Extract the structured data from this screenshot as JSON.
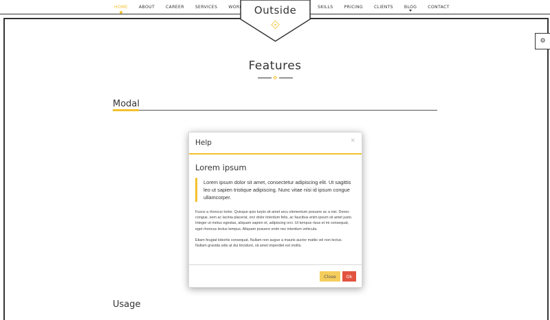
{
  "nav": {
    "left": [
      "HOME",
      "ABOUT",
      "CAREER",
      "SERVICES",
      "WORKS"
    ],
    "right": [
      "SKILLS",
      "PRICING",
      "CLIENTS",
      "BLOG",
      "CONTACT"
    ],
    "active": "HOME"
  },
  "logo": {
    "text": "Outside"
  },
  "settings": {
    "icon": "gear-icon"
  },
  "features": {
    "title": "Features"
  },
  "sections": {
    "modal_title": "Modal",
    "usage_title": "Usage"
  },
  "modal": {
    "title": "Help",
    "close_icon": "×",
    "heading": "Lorem ipsum",
    "quote": "Lorem ipsum dolor sit amet, consectetur adipiscing elit. Ut sagittis leo ut sapien tristique adipiscing. Nunc vitae nisi id ipsum congue ullamcorper.",
    "paragraph1": "Fusce a rhoncus tortor. Quisque quis turpis sit amet arcu elementum posuere ac a nisi. Donec congue, sem ac lacinia placerat, orci dolor interdum felis, ac faucibus enim ipsum sit amet justo. Integer ut metus egestas, aliquam sapien et, adipiscing orci. Ut tempus risus et mi consequat, eget rhoncus lectus tempus. Aliquam posuere enim nec interdum vehicula.",
    "paragraph2": "Etiam feugiat lobortis consequat. Nullam non augue a mauris auctor mattis vel non lectus. Nullam gravida odio at dui tincidunt, sit amet imperdiet est mollis.",
    "close_label": "Close",
    "ok_label": "Ok"
  },
  "colors": {
    "accent": "#f2c12e",
    "ok": "#e2533f",
    "close": "#f5cd5c"
  }
}
